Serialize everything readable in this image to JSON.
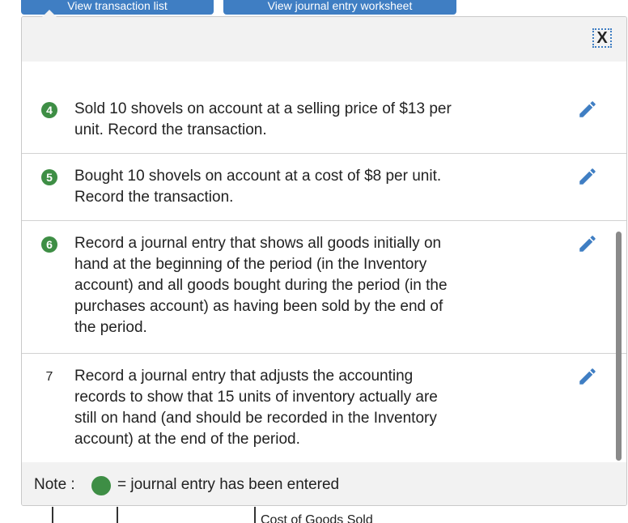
{
  "tabs": {
    "transaction_list": "View transaction list",
    "journal_worksheet": "View journal entry worksheet"
  },
  "modal": {
    "close_label": "X",
    "items": [
      {
        "number": "4",
        "entered": true,
        "text_line1": "Sold 10 shovels on account at a selling price of $13 per",
        "text_line2": "unit. Record the transaction."
      },
      {
        "number": "5",
        "entered": true,
        "text_line1": "Bought 10 shovels on account at a cost of $8 per unit.",
        "text_line2": "Record the transaction."
      },
      {
        "number": "6",
        "entered": true,
        "text_line1": "Record a journal entry that shows all goods initially on",
        "text_line2": "hand at the beginning of the period (in the Inventory",
        "text_line3": "account) and all goods bought during the period (in the",
        "text_line4": "purchases account) as having been sold by the end of",
        "text_line5": "the period."
      },
      {
        "number": "7",
        "entered": false,
        "text_line1": "Record a journal entry that adjusts the accounting",
        "text_line2": "records to show that 15 units of inventory actually are",
        "text_line3": "still on hand (and should be recorded in the Inventory",
        "text_line4": "account) at the end of the period."
      }
    ],
    "note": {
      "label": "Note :",
      "text": "= journal entry has been entered"
    }
  },
  "background": {
    "account_text": "Cost of Goods Sold"
  },
  "colors": {
    "accent_blue": "#3f7ec3",
    "entered_green": "#3e8e45",
    "header_gray": "#f2f2f2"
  },
  "icons": {
    "edit": "pencil-icon",
    "close": "close-icon",
    "entered": "filled-circle-icon"
  }
}
